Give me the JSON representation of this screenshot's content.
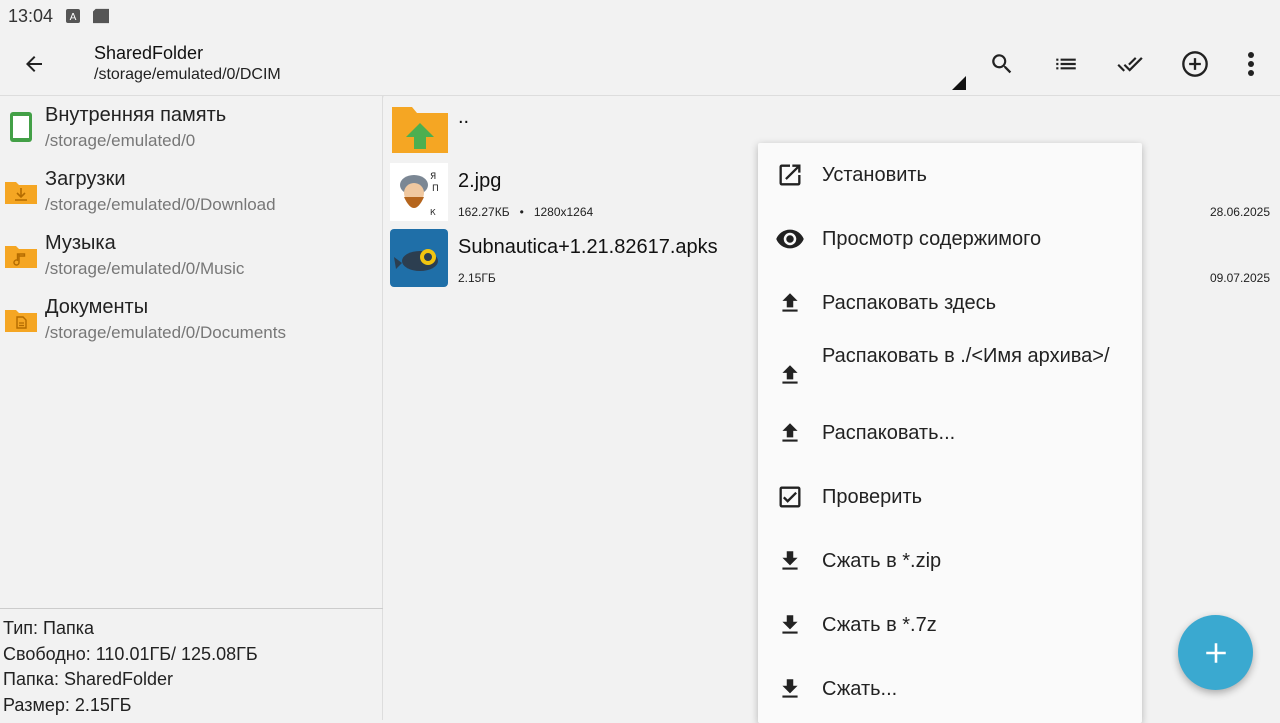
{
  "status_bar": {
    "time": "13:04",
    "icons": [
      "keyboard-a-icon",
      "sd-card-icon"
    ]
  },
  "toolbar": {
    "title": "SharedFolder",
    "path": "/storage/emulated/0/DCIM",
    "actions": [
      "search-icon",
      "list-view-icon",
      "select-all-icon",
      "add-circle-icon",
      "more-vert-icon"
    ]
  },
  "sidebar": {
    "items": [
      {
        "name": "Внутренняя память",
        "path": "/storage/emulated/0",
        "icon": "phone-storage-icon"
      },
      {
        "name": "Загрузки",
        "path": "/storage/emulated/0/Download",
        "icon": "download-folder-icon"
      },
      {
        "name": "Музыка",
        "path": "/storage/emulated/0/Music",
        "icon": "music-folder-icon"
      },
      {
        "name": "Документы",
        "path": "/storage/emulated/0/Documents",
        "icon": "documents-folder-icon"
      }
    ],
    "info": {
      "type": "Тип: Папка",
      "free": "Свободно: 110.01ГБ/ 125.08ГБ",
      "folder": "Папка: SharedFolder",
      "size": "Размер: 2.15ГБ"
    }
  },
  "files": [
    {
      "name": "..",
      "icon": "parent-folder-icon"
    },
    {
      "name": "2.jpg",
      "size": "162.27КБ",
      "dims": "1280x1264",
      "date": "28.06.2025",
      "icon": "image-thumbnail"
    },
    {
      "name": "Subnautica+1.21.82617.apks",
      "size": "2.15ГБ",
      "date": "09.07.2025",
      "icon": "apk-thumbnail"
    }
  ],
  "meta_separator": "•",
  "context_menu": {
    "items": [
      {
        "label": "Установить",
        "icon": "open-external-icon"
      },
      {
        "label": "Просмотр содержимого",
        "icon": "eye-icon"
      },
      {
        "label": "Распаковать здесь",
        "icon": "upload-icon"
      },
      {
        "label": "Распаковать в ./<Имя архива>/",
        "icon": "upload-icon"
      },
      {
        "label": "Распаковать...",
        "icon": "upload-icon"
      },
      {
        "label": "Проверить",
        "icon": "checkbox-icon"
      },
      {
        "label": "Сжать в *.zip",
        "icon": "download-icon"
      },
      {
        "label": "Сжать в *.7z",
        "icon": "download-icon"
      },
      {
        "label": "Сжать...",
        "icon": "download-icon"
      }
    ]
  },
  "colors": {
    "accent": "#3aa9d0",
    "folder": "#f5a623",
    "storage": "#43a047"
  }
}
